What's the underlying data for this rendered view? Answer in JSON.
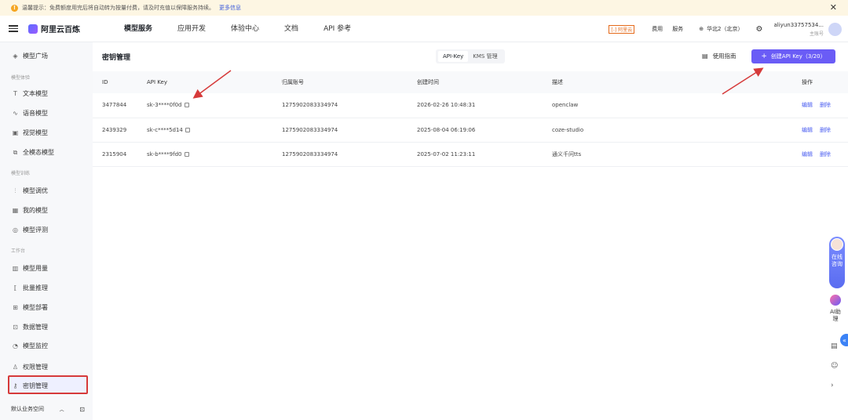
{
  "banner": {
    "text": "温馨提示：免费额度用完后将自动转为按量付费，请及时充值以保障服务持续。",
    "link": "更多信息",
    "close": "✕"
  },
  "topbar": {
    "logo": "阿里云百炼",
    "nav": [
      "模型服务",
      "应用开发",
      "体验中心",
      "文档",
      "API 参考"
    ],
    "aliyun": "[-] 阿里云",
    "fees": "费用",
    "service": "服务",
    "region": "华北2（北京）",
    "user_name": "aliyun33757534...",
    "user_sub": "主账号"
  },
  "sidebar": {
    "groups": [
      "模型体验",
      "模型训练",
      "工作台"
    ],
    "items": [
      {
        "label": "模型广场",
        "icon": "cube-icon"
      },
      {
        "label": "文本模型",
        "icon": "text-icon"
      },
      {
        "label": "语音模型",
        "icon": "voice-icon"
      },
      {
        "label": "视觉模型",
        "icon": "camera-icon"
      },
      {
        "label": "全模态模型",
        "icon": "multimodal-icon"
      },
      {
        "label": "模型调优",
        "icon": "sliders-icon"
      },
      {
        "label": "我的模型",
        "icon": "grid-icon"
      },
      {
        "label": "模型评测",
        "icon": "compass-icon"
      },
      {
        "label": "模型用量",
        "icon": "bar-chart-icon"
      },
      {
        "label": "批量推理",
        "icon": "batch-icon"
      },
      {
        "label": "模型部署",
        "icon": "deploy-icon"
      },
      {
        "label": "数据管理",
        "icon": "data-icon"
      },
      {
        "label": "模型监控",
        "icon": "pie-icon"
      },
      {
        "label": "权限管理",
        "icon": "user-icon"
      },
      {
        "label": "密钥管理",
        "icon": "key-icon"
      }
    ],
    "footer": "默认业务空间"
  },
  "main": {
    "title": "密钥管理",
    "tabs": [
      "API-Key",
      "KMS 管理"
    ],
    "guide": "使用指南",
    "create_button": "创建API Key（3/20）",
    "columns": [
      "ID",
      "API Key",
      "归属账号",
      "创建时间",
      "描述",
      "操作"
    ],
    "rows": [
      {
        "id": "3477844",
        "key": "sk-3****0f0d",
        "account": "1275902083334974",
        "time": "2026-02-26 10:48:31",
        "desc": "openclaw"
      },
      {
        "id": "2439329",
        "key": "sk-c****5d14",
        "account": "1275902083334974",
        "time": "2025-08-04 06:19:06",
        "desc": "coze-studio"
      },
      {
        "id": "2315904",
        "key": "sk-b****9fd0",
        "account": "1275902083334974",
        "time": "2025-07-02 11:23:11",
        "desc": "通义千问tts"
      }
    ],
    "edit": "编辑",
    "delete": "删除"
  },
  "right_tools": {
    "online": "在线咨询",
    "ai": "AI助理"
  },
  "colors": {
    "accent": "#6a5cf6",
    "highlight": "#d63a3a",
    "link": "#4a5df0"
  }
}
